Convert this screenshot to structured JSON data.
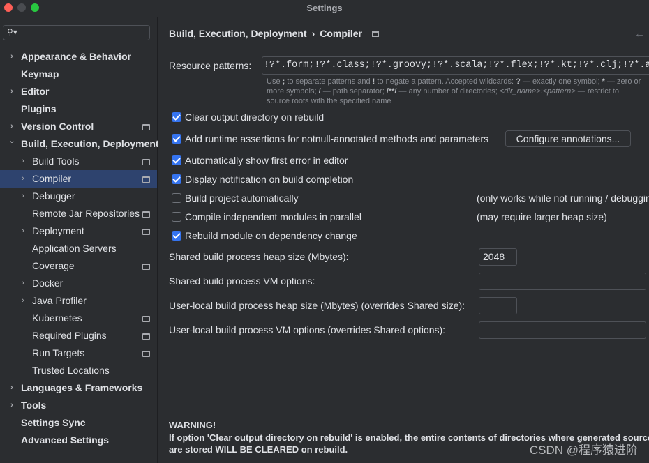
{
  "window": {
    "title": "Settings"
  },
  "search": {
    "placeholder": "",
    "value": ""
  },
  "sidebar": {
    "items": [
      {
        "label": "Appearance & Behavior",
        "level": 0,
        "arrow": "›",
        "bold": true,
        "icon": false,
        "selected": false
      },
      {
        "label": "Keymap",
        "level": 0,
        "arrow": "",
        "bold": true,
        "icon": false,
        "selected": false
      },
      {
        "label": "Editor",
        "level": 0,
        "arrow": "›",
        "bold": true,
        "icon": false,
        "selected": false
      },
      {
        "label": "Plugins",
        "level": 0,
        "arrow": "",
        "bold": true,
        "icon": false,
        "selected": false
      },
      {
        "label": "Version Control",
        "level": 0,
        "arrow": "›",
        "bold": true,
        "icon": true,
        "selected": false
      },
      {
        "label": "Build, Execution, Deployment",
        "level": 0,
        "arrow": "⌄",
        "bold": true,
        "icon": false,
        "selected": false
      },
      {
        "label": "Build Tools",
        "level": 1,
        "arrow": "›",
        "bold": false,
        "icon": true,
        "selected": false
      },
      {
        "label": "Compiler",
        "level": 1,
        "arrow": "›",
        "bold": false,
        "icon": true,
        "selected": true
      },
      {
        "label": "Debugger",
        "level": 1,
        "arrow": "›",
        "bold": false,
        "icon": false,
        "selected": false
      },
      {
        "label": "Remote Jar Repositories",
        "level": 1,
        "arrow": "",
        "bold": false,
        "icon": true,
        "selected": false
      },
      {
        "label": "Deployment",
        "level": 1,
        "arrow": "›",
        "bold": false,
        "icon": true,
        "selected": false
      },
      {
        "label": "Application Servers",
        "level": 1,
        "arrow": "",
        "bold": false,
        "icon": false,
        "selected": false
      },
      {
        "label": "Coverage",
        "level": 1,
        "arrow": "",
        "bold": false,
        "icon": true,
        "selected": false
      },
      {
        "label": "Docker",
        "level": 1,
        "arrow": "›",
        "bold": false,
        "icon": false,
        "selected": false
      },
      {
        "label": "Java Profiler",
        "level": 1,
        "arrow": "›",
        "bold": false,
        "icon": false,
        "selected": false
      },
      {
        "label": "Kubernetes",
        "level": 1,
        "arrow": "",
        "bold": false,
        "icon": true,
        "selected": false
      },
      {
        "label": "Required Plugins",
        "level": 1,
        "arrow": "",
        "bold": false,
        "icon": true,
        "selected": false
      },
      {
        "label": "Run Targets",
        "level": 1,
        "arrow": "",
        "bold": false,
        "icon": true,
        "selected": false
      },
      {
        "label": "Trusted Locations",
        "level": 1,
        "arrow": "",
        "bold": false,
        "icon": false,
        "selected": false
      },
      {
        "label": "Languages & Frameworks",
        "level": 0,
        "arrow": "›",
        "bold": true,
        "icon": false,
        "selected": false
      },
      {
        "label": "Tools",
        "level": 0,
        "arrow": "›",
        "bold": true,
        "icon": false,
        "selected": false
      },
      {
        "label": "Settings Sync",
        "level": 0,
        "arrow": "",
        "bold": true,
        "icon": false,
        "selected": false
      },
      {
        "label": "Advanced Settings",
        "level": 0,
        "arrow": "",
        "bold": true,
        "icon": false,
        "selected": false
      }
    ]
  },
  "breadcrumb": {
    "parent": "Build, Execution, Deployment",
    "separator": "›",
    "current": "Compiler"
  },
  "resource": {
    "label": "Resource patterns:",
    "value": "!?*.form;!?*.class;!?*.groovy;!?*.scala;!?*.flex;!?*.kt;!?*.clj;!?*.aj",
    "hint_line1_a": "Use ",
    "hint_line1_b": ";",
    "hint_line1_c": " to separate patterns and ",
    "hint_line1_d": "!",
    "hint_line1_e": " to negate a pattern. Accepted wildcards: ",
    "hint_line1_f": "?",
    "hint_line1_g": " — exactly one symbol; ",
    "hint_line1_h": "*",
    "hint_line1_i": " — zero or",
    "hint_line2_a": "more symbols; ",
    "hint_line2_b": "/",
    "hint_line2_c": " — path separator; ",
    "hint_line2_d": "/**/",
    "hint_line2_e": " — any number of directories; ",
    "hint_line2_f": "<dir_name>:<pattern>",
    "hint_line2_g": " — restrict to",
    "hint_line3": "source roots with the specified name"
  },
  "options": {
    "clear_output": {
      "label": "Clear output directory on rebuild",
      "checked": true
    },
    "runtime_assertions": {
      "label": "Add runtime assertions for notnull-annotated methods and parameters",
      "checked": true
    },
    "configure_annotations": "Configure annotations...",
    "show_first_error": {
      "label": "Automatically show first error in editor",
      "checked": true
    },
    "display_notification": {
      "label": "Display notification on build completion",
      "checked": true
    },
    "build_automatically": {
      "label": "Build project automatically",
      "checked": false,
      "note": "(only works while not running / debugging)"
    },
    "compile_parallel": {
      "label": "Compile independent modules in parallel",
      "checked": false,
      "note": "(may require larger heap size)"
    },
    "rebuild_module": {
      "label": "Rebuild module on dependency change",
      "checked": true
    }
  },
  "fields": {
    "shared_heap": {
      "label": "Shared build process heap size (Mbytes):",
      "value": "2048"
    },
    "shared_vm": {
      "label": "Shared build process VM options:",
      "value": ""
    },
    "local_heap": {
      "label": "User-local build process heap size (Mbytes) (overrides Shared size):",
      "value": ""
    },
    "local_vm": {
      "label": "User-local build process VM options (overrides Shared options):",
      "value": ""
    }
  },
  "warning": {
    "title": "WARNING!",
    "line1": "If option 'Clear output directory on rebuild' is enabled, the entire contents of directories where generated sources",
    "line2": "are stored WILL BE CLEARED on rebuild."
  },
  "watermark": "CSDN @程序猿进阶",
  "colors": {
    "accent": "#3574f0",
    "selection": "#2e436e",
    "background": "#2b2d30"
  }
}
